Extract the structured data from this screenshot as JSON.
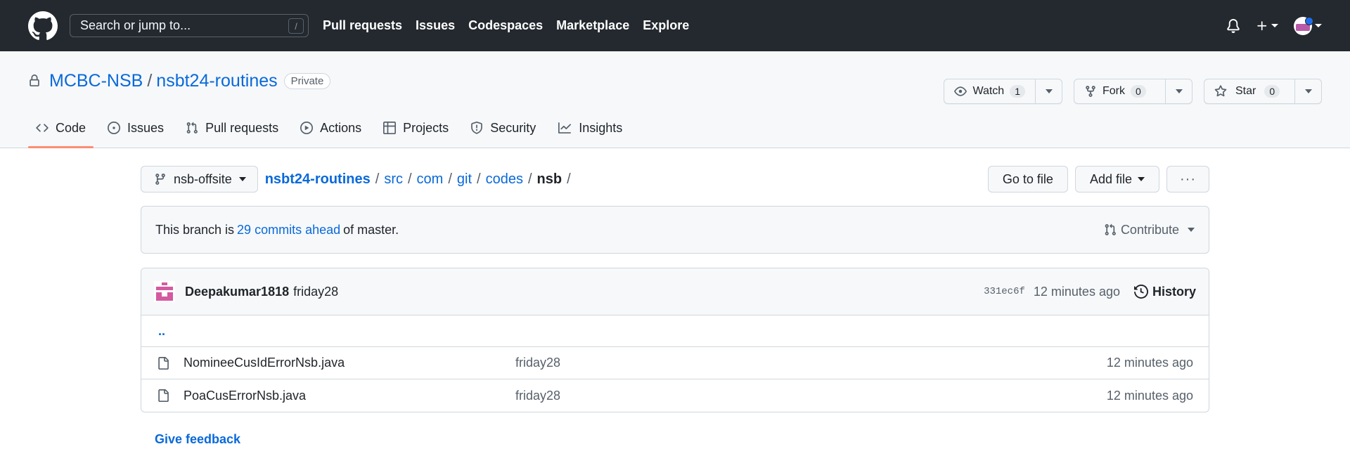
{
  "header": {
    "search_placeholder": "Search or jump to...",
    "search_shortcut": "/",
    "nav": [
      "Pull requests",
      "Issues",
      "Codespaces",
      "Marketplace",
      "Explore"
    ]
  },
  "repo": {
    "owner": "MCBC-NSB",
    "name": "nsbt24-routines",
    "visibility": "Private",
    "watch_label": "Watch",
    "watch_count": "1",
    "fork_label": "Fork",
    "fork_count": "0",
    "star_label": "Star",
    "star_count": "0"
  },
  "tabs": [
    "Code",
    "Issues",
    "Pull requests",
    "Actions",
    "Projects",
    "Security",
    "Insights"
  ],
  "path": {
    "branch": "nsb-offsite",
    "root": "nsbt24-routines",
    "segments": [
      "src",
      "com",
      "git",
      "codes"
    ],
    "current": "nsb",
    "trailing_sep": "/",
    "go_to_file": "Go to file",
    "add_file": "Add file",
    "more": "···"
  },
  "branch_info": {
    "prefix": "This branch is",
    "link": "29 commits ahead",
    "suffix": "of master.",
    "contribute": "Contribute"
  },
  "latest_commit": {
    "author": "Deepakumar1818",
    "message": "friday28",
    "sha": "331ec6f",
    "time": "12 minutes ago",
    "history": "History"
  },
  "parent_dir": "..",
  "files": [
    {
      "name": "NomineeCusIdErrorNsb.java",
      "commit": "friday28",
      "age": "12 minutes ago"
    },
    {
      "name": "PoaCusErrorNsb.java",
      "commit": "friday28",
      "age": "12 minutes ago"
    }
  ],
  "feedback": "Give feedback",
  "colors": {
    "header_bg": "#24292f",
    "link": "#0969da",
    "active_tab_underline": "#fd8c73",
    "avatar_accent": "#1f6feb"
  }
}
